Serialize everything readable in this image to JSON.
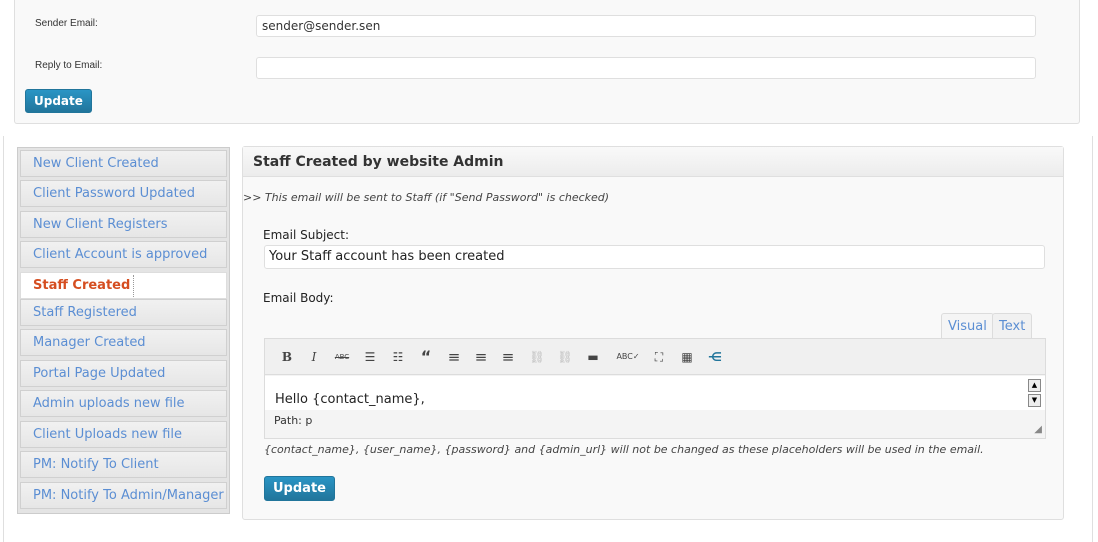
{
  "top_settings": {
    "sender_email_label": "Sender Email:",
    "sender_email_value": "sender@sender.sen",
    "reply_to_label": "Reply to Email:",
    "reply_to_value": "",
    "update_label": "Update"
  },
  "sidebar": {
    "items": [
      {
        "label": "New Client Created",
        "active": false
      },
      {
        "label": "Client Password Updated",
        "active": false
      },
      {
        "label": "New Client Registers",
        "active": false
      },
      {
        "label": "Client Account is approved",
        "active": false
      },
      {
        "label": "Staff Created",
        "active": true
      },
      {
        "label": "Staff Registered",
        "active": false
      },
      {
        "label": "Manager Created",
        "active": false
      },
      {
        "label": "Portal Page Updated",
        "active": false
      },
      {
        "label": "Admin uploads new file",
        "active": false
      },
      {
        "label": "Client Uploads new file",
        "active": false
      },
      {
        "label": "PM: Notify To Client",
        "active": false
      },
      {
        "label": "PM: Notify To Admin/Manager",
        "active": false
      }
    ]
  },
  "panel": {
    "title": "Staff Created by website Admin",
    "note": ">> This email will be sent to Staff (if \"Send Password\" is checked)",
    "subject_label": "Email Subject:",
    "subject_value": "Your Staff account has been created",
    "body_label": "Email Body:",
    "tab_visual": "Visual",
    "tab_text": "Text",
    "toolbar": {
      "bold": "B",
      "italic": "I",
      "strike": "ABC",
      "bullet_list": "☰",
      "numbered_list": "☷",
      "blockquote": "“",
      "align_left": "≡",
      "align_center": "≡",
      "align_right": "≡",
      "link": "⛓",
      "unlink": "⛓",
      "more": "▬",
      "spellcheck": "ABC✓",
      "fullscreen": "⛶",
      "kitchen_sink": "▦",
      "extra": "⋲"
    },
    "body_content": "Hello {contact_name},",
    "path_text": "Path: p",
    "placeholders_note": "{contact_name}, {user_name}, {password} and {admin_url} will not be changed as these placeholders will be used in the email.",
    "update_label": "Update"
  },
  "colors": {
    "accent": "#21759b",
    "link": "#5b8ed3",
    "active_tab": "#d54e21"
  }
}
